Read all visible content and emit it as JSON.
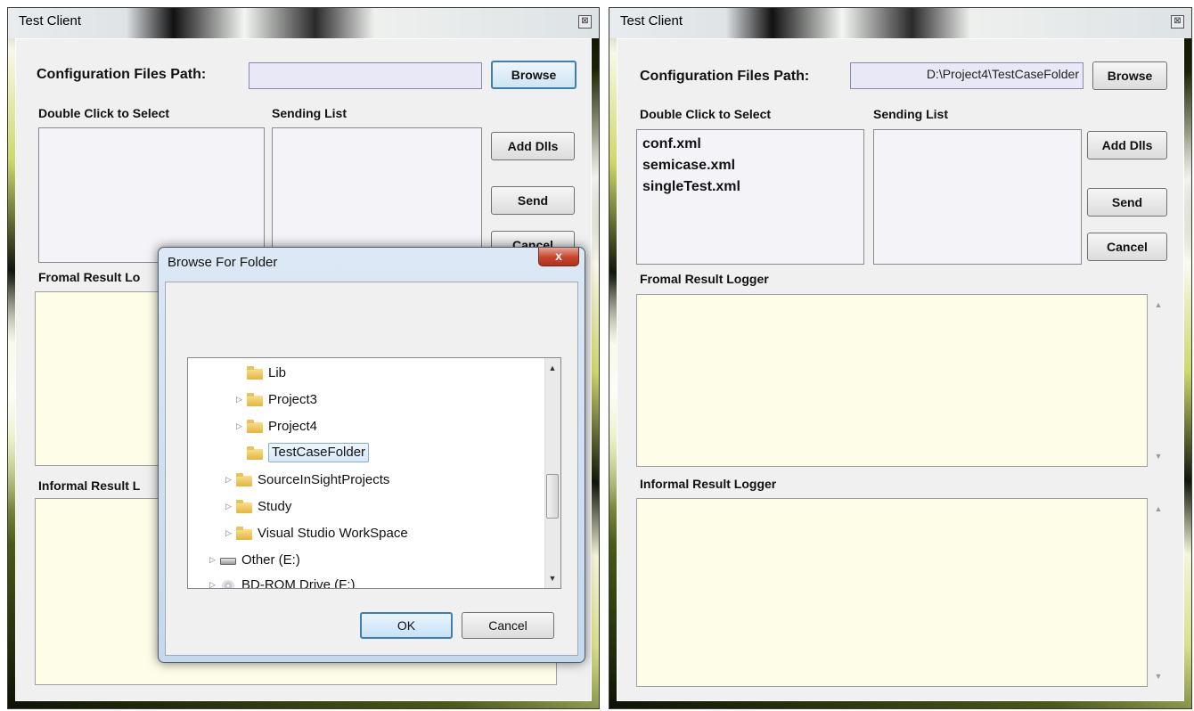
{
  "left": {
    "title": "Test Client",
    "config_label": "Configuration Files Path:",
    "config_value": "",
    "browse": "Browse",
    "double_click_label": "Double Click to Select",
    "sending_list_label": "Sending List",
    "add_dlls": "Add Dlls",
    "send": "Send",
    "cancel": "Cancel",
    "formal_label": "Fromal Result Lo",
    "informal_label": "Informal Result L"
  },
  "dialog": {
    "title": "Browse For Folder",
    "close": "x",
    "tree": [
      {
        "label": "Lib",
        "expandable": false,
        "icon": "folder-icon"
      },
      {
        "label": "Project3",
        "expandable": true,
        "icon": "folder-icon"
      },
      {
        "label": "Project4",
        "expandable": true,
        "icon": "folder-icon"
      },
      {
        "label": "TestCaseFolder",
        "expandable": false,
        "icon": "folder-icon",
        "selected": true
      },
      {
        "label": "SourceInSightProjects",
        "expandable": true,
        "icon": "folder-icon"
      },
      {
        "label": "Study",
        "expandable": true,
        "icon": "folder-icon"
      },
      {
        "label": "Visual Studio WorkSpace",
        "expandable": true,
        "icon": "folder-icon"
      },
      {
        "label": "Other (E:)",
        "expandable": true,
        "icon": "drive-icon"
      },
      {
        "label": "BD-ROM Drive (F:)",
        "expandable": true,
        "icon": "disc-drive-icon"
      }
    ],
    "ok": "OK",
    "cancel": "Cancel"
  },
  "right": {
    "title": "Test Client",
    "config_label": "Configuration Files Path:",
    "config_value": "D:\\Project4\\TestCaseFolder",
    "browse": "Browse",
    "double_click_label": "Double Click to Select",
    "sending_list_label": "Sending List",
    "files": [
      "conf.xml",
      "semicase.xml",
      "singleTest.xml"
    ],
    "add_dlls": "Add Dlls",
    "send": "Send",
    "cancel": "Cancel",
    "formal_label": "Fromal Result Logger",
    "informal_label": "Informal Result Logger"
  }
}
